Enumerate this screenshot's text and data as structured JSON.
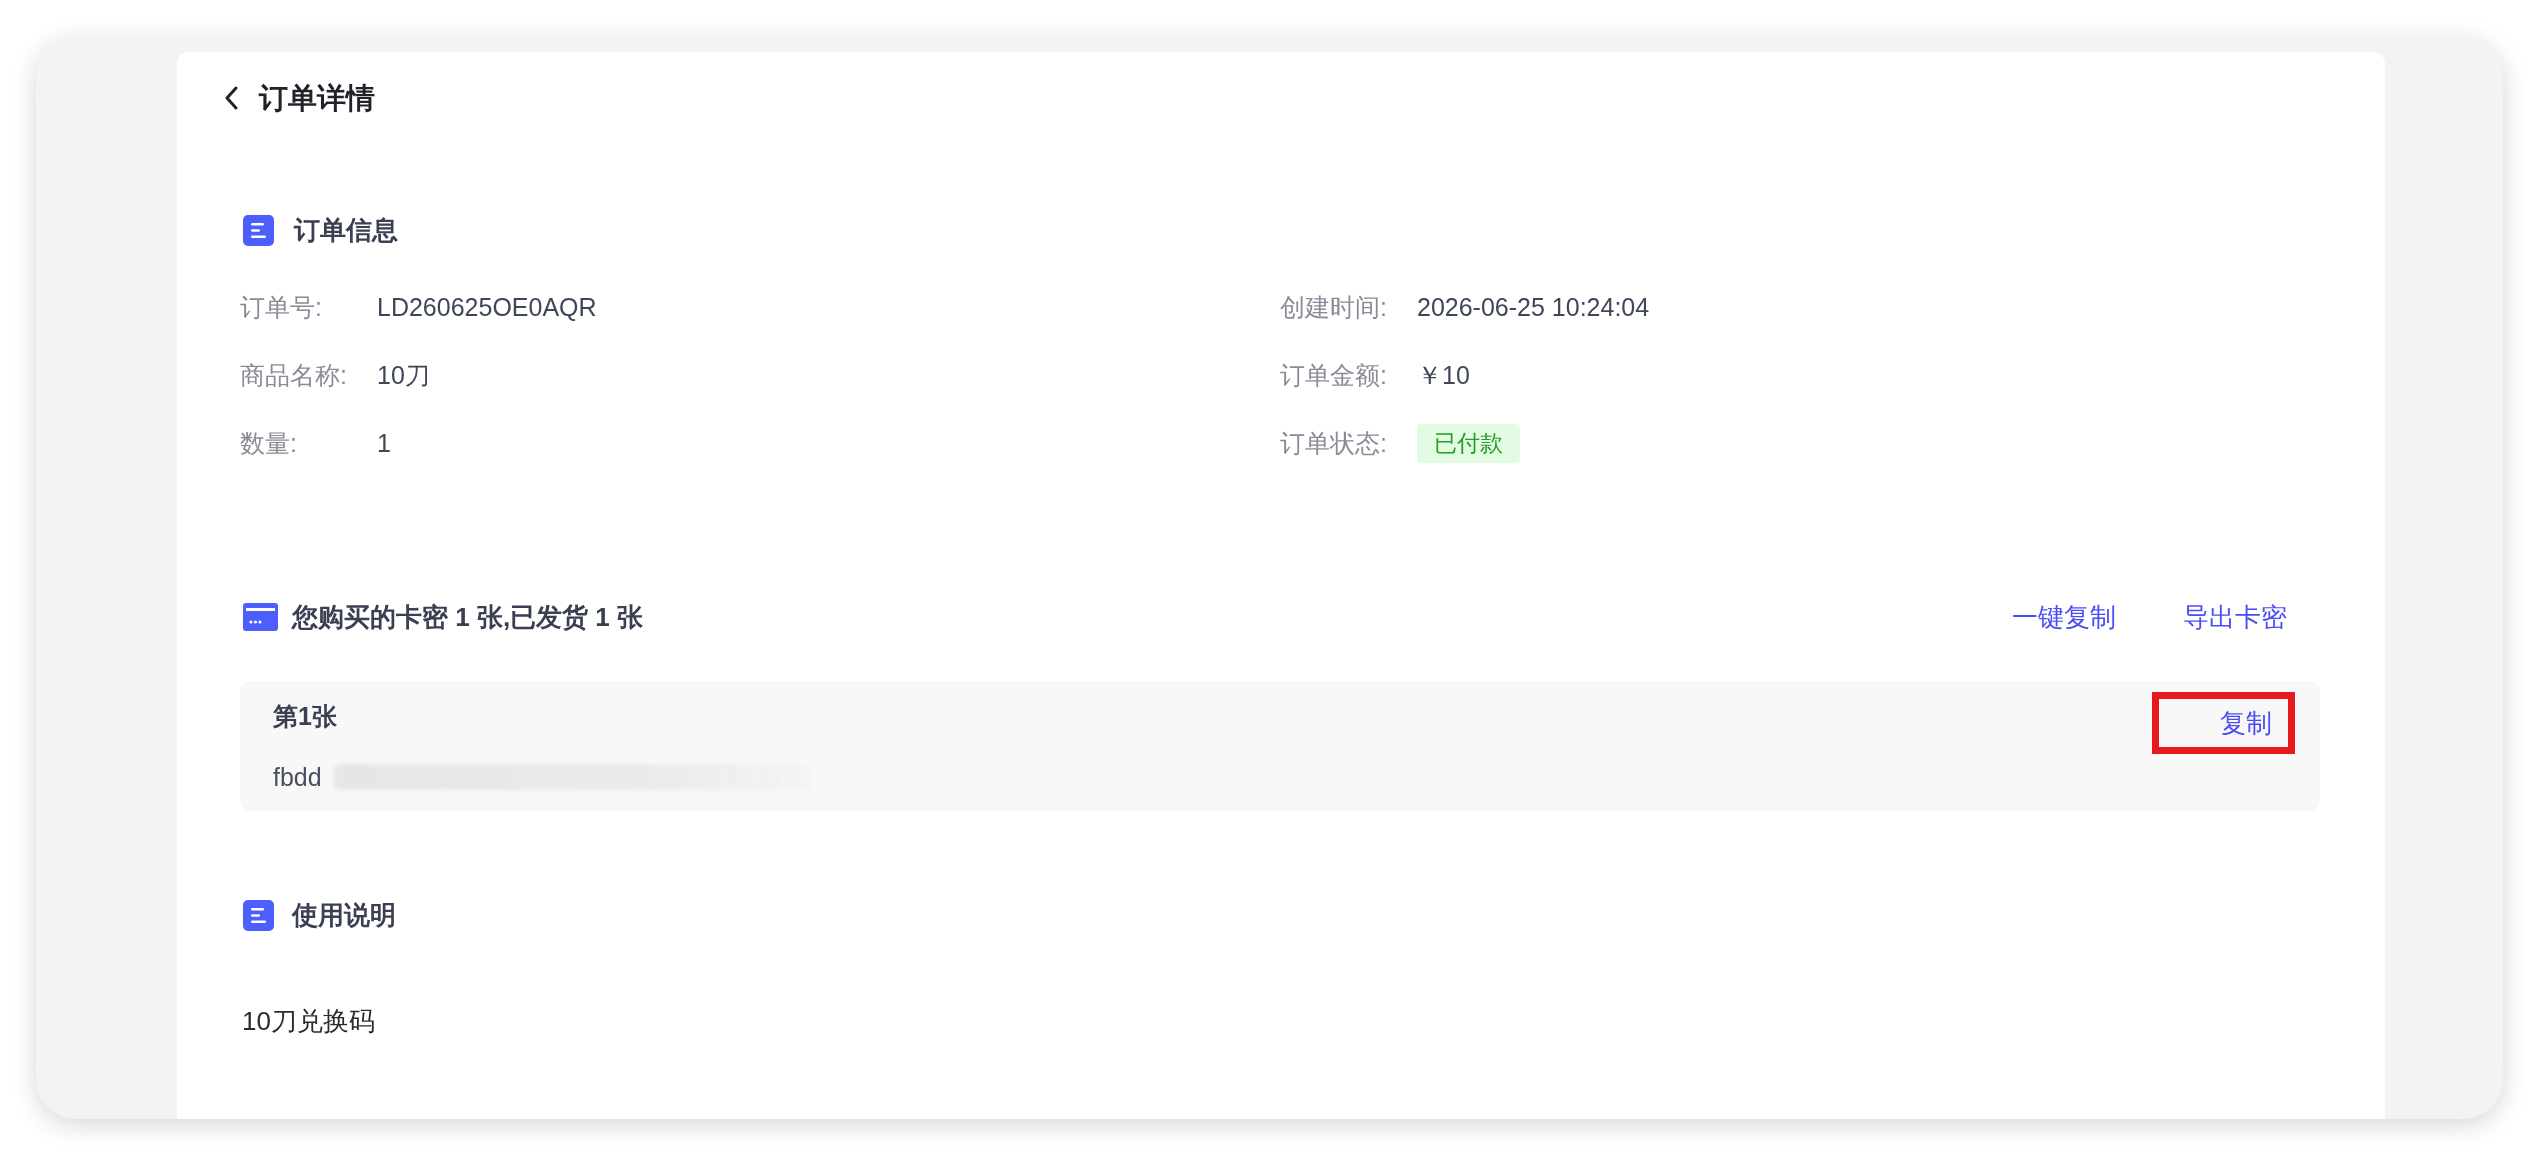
{
  "header": {
    "title": "订单详情"
  },
  "order_info": {
    "title": "订单信息",
    "fields": [
      {
        "label": "订单号:",
        "value": "LD260625OE0AQR",
        "kind": "text"
      },
      {
        "label": "创建时间:",
        "value": "2026-06-25 10:24:04",
        "kind": "text"
      },
      {
        "label": "商品名称:",
        "value": "10刀",
        "kind": "text"
      },
      {
        "label": "订单金额:",
        "value": "￥10",
        "kind": "text"
      },
      {
        "label": "数量:",
        "value": "1",
        "kind": "text"
      },
      {
        "label": "订单状态:",
        "value": "已付款",
        "kind": "badge"
      }
    ]
  },
  "card_keys": {
    "title": "您购买的卡密 1 张,已发货 1 张",
    "actions": [
      "一键复制",
      "导出卡密"
    ],
    "cards": [
      {
        "title": "第1张",
        "code": "fbdd",
        "redacted": true,
        "copy_label": "复制",
        "highlighted": true
      }
    ]
  },
  "usage": {
    "title": "使用说明",
    "text": "10刀兑换码"
  }
}
